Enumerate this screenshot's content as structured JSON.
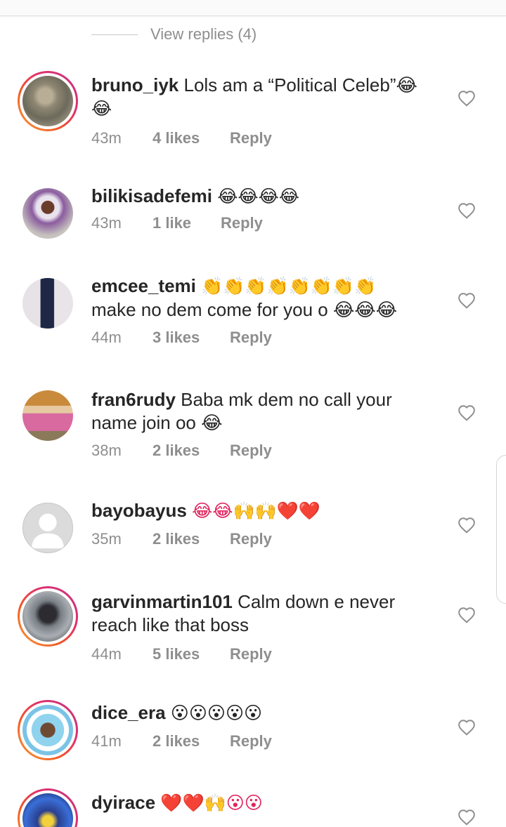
{
  "view_replies": "View replies (4)",
  "colors": {
    "text": "#262626",
    "muted": "#8e8e8e",
    "story_ring": "#e1306c"
  },
  "comments": [
    {
      "username": "bruno_iyk",
      "text": "Lols am a “Political Celeb”😂",
      "text2": "😂",
      "time": "43m",
      "likes": "4 likes",
      "reply": "Reply",
      "story": true,
      "avatar_icon": "user-photo-icon"
    },
    {
      "username": "bilikisadefemi",
      "text": "😂😂😂😂",
      "text2": "",
      "time": "43m",
      "likes": "1 like",
      "reply": "Reply",
      "story": false,
      "avatar_icon": "user-photo-icon"
    },
    {
      "username": "emcee_temi",
      "text": "👏👏👏👏👏👏👏👏",
      "text2": "make no dem come for you o 😂😂😂",
      "time": "44m",
      "likes": "3 likes",
      "reply": "Reply",
      "story": false,
      "avatar_icon": "user-photo-icon"
    },
    {
      "username": "fran6rudy",
      "text": "Baba mk dem no call your",
      "text2": "name join oo 😂",
      "time": "38m",
      "likes": "2 likes",
      "reply": "Reply",
      "story": false,
      "avatar_icon": "user-photo-icon"
    },
    {
      "username": "bayobayus",
      "text": "😂😂🙌🙌❤️❤️",
      "text2": "",
      "time": "35m",
      "likes": "2 likes",
      "reply": "Reply",
      "story": false,
      "avatar_icon": "default-avatar-icon"
    },
    {
      "username": "garvinmartin101",
      "text": "Calm down e never",
      "text2": "reach like that boss",
      "time": "44m",
      "likes": "5 likes",
      "reply": "Reply",
      "story": true,
      "avatar_icon": "user-photo-icon"
    },
    {
      "username": "dice_era",
      "text": "😮😮😮😮😮",
      "text2": "",
      "time": "41m",
      "likes": "2 likes",
      "reply": "Reply",
      "story": true,
      "avatar_icon": "user-photo-icon"
    },
    {
      "username": "dyirace",
      "text": "❤️❤️🙌😮😮",
      "text2": "",
      "time": "",
      "likes": "",
      "reply": "",
      "story": true,
      "avatar_icon": "user-photo-icon"
    }
  ]
}
